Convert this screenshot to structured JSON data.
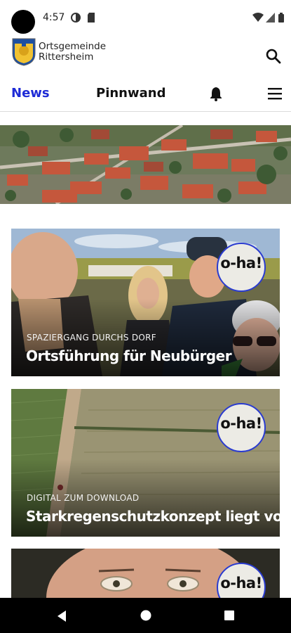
{
  "status_bar": {
    "time": "4:57"
  },
  "header": {
    "org_line1": "Ortsgemeinde",
    "org_line2": "Rittersheim"
  },
  "nav": {
    "news": "News",
    "pinnwand": "Pinnwand"
  },
  "articles": [
    {
      "category": "SPAZIERGANG DURCHS DORF",
      "title": "Ortsführung für Neubürger",
      "badge": "o-ha!"
    },
    {
      "category": "DIGITAL ZUM DOWNLOAD",
      "title": "Starkregenschutzkonzept liegt vor",
      "badge": "o-ha!"
    },
    {
      "category": "",
      "title": "",
      "badge": "o-ha!"
    }
  ],
  "icons": {
    "status": [
      "camera-cutout",
      "circle-status-icon",
      "sd-card-icon",
      "wifi-icon",
      "signal-icon",
      "battery-icon"
    ],
    "header": [
      "coat-of-arms-logo",
      "search-icon"
    ],
    "nav": [
      "bell-icon",
      "hamburger-menu-icon"
    ],
    "system_nav": [
      "back-icon",
      "home-icon",
      "recents-icon"
    ]
  },
  "colors": {
    "accent": "#1e2bd6",
    "badge_border": "#2a3bd0"
  }
}
